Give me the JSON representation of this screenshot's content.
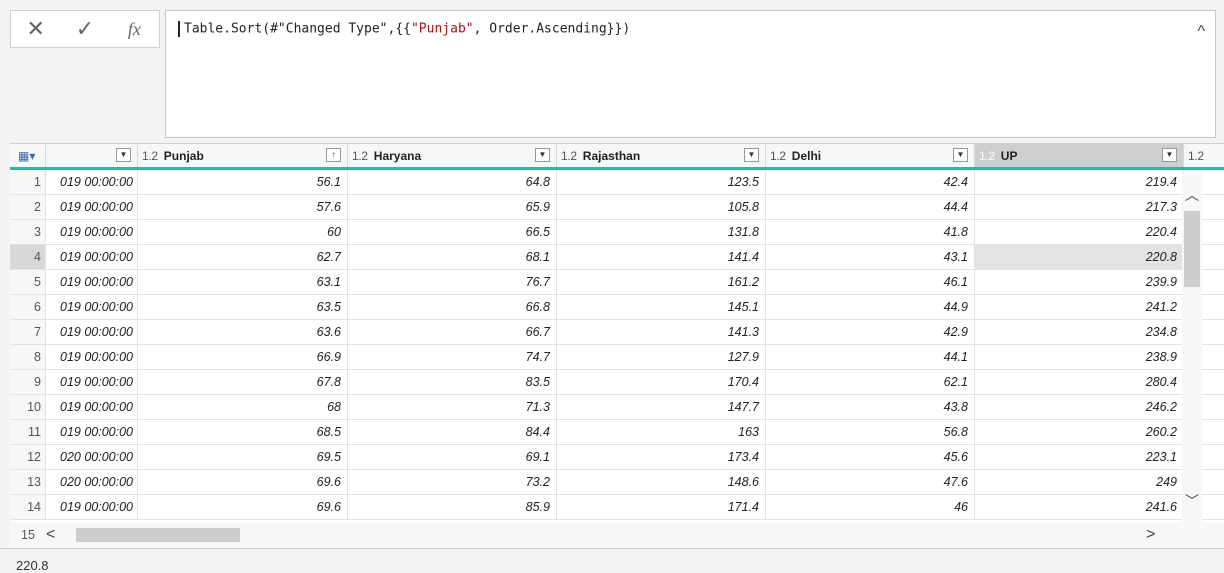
{
  "formula_bar": {
    "cancel_label": "✕",
    "commit_label": "✓",
    "fx_label": "fx",
    "formula_prefix": "Table.Sort(#\"Changed Type\",{{",
    "formula_string": "\"Punjab\"",
    "formula_suffix": ", Order.Ascending}})",
    "collapse_label": "^"
  },
  "columns": [
    {
      "type": "",
      "name": "",
      "sort": "▼"
    },
    {
      "type": "1.2",
      "name": "Punjab",
      "sort": "↑"
    },
    {
      "type": "1.2",
      "name": "Haryana",
      "sort": "▼"
    },
    {
      "type": "1.2",
      "name": "Rajasthan",
      "sort": "▼"
    },
    {
      "type": "1.2",
      "name": "Delhi",
      "sort": "▼"
    },
    {
      "type": "1.2",
      "name": "UP",
      "sort": "▼"
    },
    {
      "type": "1.2",
      "name": "",
      "sort": ""
    }
  ],
  "rows": [
    {
      "idx": "1",
      "date": "019 00:00:00",
      "punjab": "56.1",
      "haryana": "64.8",
      "rajasthan": "123.5",
      "delhi": "42.4",
      "up": "219.4"
    },
    {
      "idx": "2",
      "date": "019 00:00:00",
      "punjab": "57.6",
      "haryana": "65.9",
      "rajasthan": "105.8",
      "delhi": "44.4",
      "up": "217.3"
    },
    {
      "idx": "3",
      "date": "019 00:00:00",
      "punjab": "60",
      "haryana": "66.5",
      "rajasthan": "131.8",
      "delhi": "41.8",
      "up": "220.4"
    },
    {
      "idx": "4",
      "date": "019 00:00:00",
      "punjab": "62.7",
      "haryana": "68.1",
      "rajasthan": "141.4",
      "delhi": "43.1",
      "up": "220.8"
    },
    {
      "idx": "5",
      "date": "019 00:00:00",
      "punjab": "63.1",
      "haryana": "76.7",
      "rajasthan": "161.2",
      "delhi": "46.1",
      "up": "239.9"
    },
    {
      "idx": "6",
      "date": "019 00:00:00",
      "punjab": "63.5",
      "haryana": "66.8",
      "rajasthan": "145.1",
      "delhi": "44.9",
      "up": "241.2"
    },
    {
      "idx": "7",
      "date": "019 00:00:00",
      "punjab": "63.6",
      "haryana": "66.7",
      "rajasthan": "141.3",
      "delhi": "42.9",
      "up": "234.8"
    },
    {
      "idx": "8",
      "date": "019 00:00:00",
      "punjab": "66.9",
      "haryana": "74.7",
      "rajasthan": "127.9",
      "delhi": "44.1",
      "up": "238.9"
    },
    {
      "idx": "9",
      "date": "019 00:00:00",
      "punjab": "67.8",
      "haryana": "83.5",
      "rajasthan": "170.4",
      "delhi": "62.1",
      "up": "280.4"
    },
    {
      "idx": "10",
      "date": "019 00:00:00",
      "punjab": "68",
      "haryana": "71.3",
      "rajasthan": "147.7",
      "delhi": "43.8",
      "up": "246.2"
    },
    {
      "idx": "11",
      "date": "019 00:00:00",
      "punjab": "68.5",
      "haryana": "84.4",
      "rajasthan": "163",
      "delhi": "56.8",
      "up": "260.2"
    },
    {
      "idx": "12",
      "date": "020 00:00:00",
      "punjab": "69.5",
      "haryana": "69.1",
      "rajasthan": "173.4",
      "delhi": "45.6",
      "up": "223.1"
    },
    {
      "idx": "13",
      "date": "020 00:00:00",
      "punjab": "69.6",
      "haryana": "73.2",
      "rajasthan": "148.6",
      "delhi": "47.6",
      "up": "249"
    },
    {
      "idx": "14",
      "date": "019 00:00:00",
      "punjab": "69.6",
      "haryana": "85.9",
      "rajasthan": "171.4",
      "delhi": "46",
      "up": "241.6"
    }
  ],
  "last_row_index": "15",
  "status_value": "220.8",
  "colors": {
    "accent": "#2fb5a0",
    "selected_header": "#cfcfcf"
  }
}
